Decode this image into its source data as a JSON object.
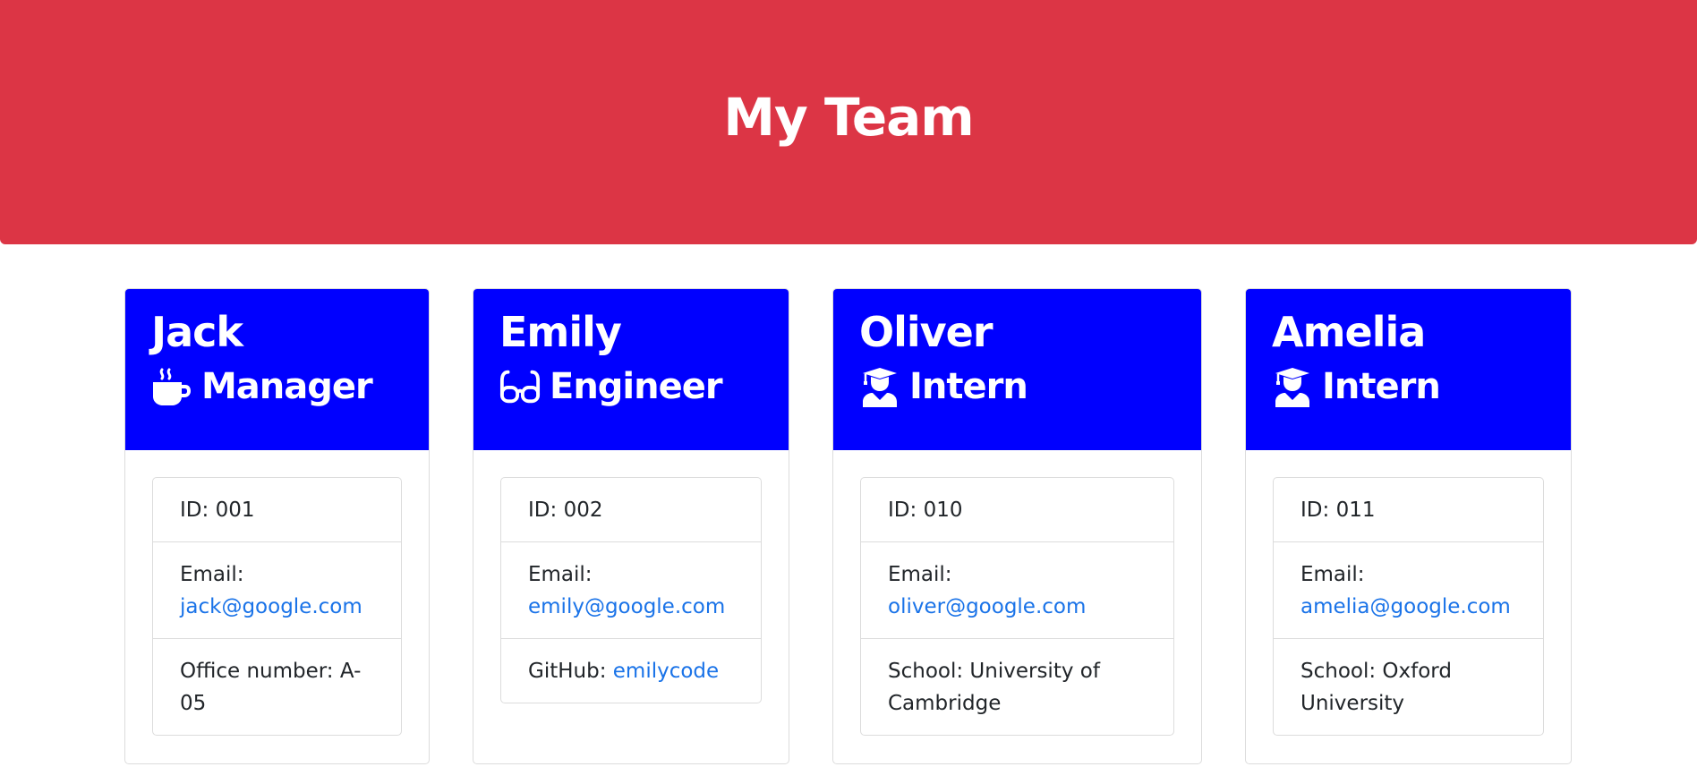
{
  "header": {
    "title": "My Team",
    "background_color": "#dc3545"
  },
  "card_header_color": "#0000ff",
  "link_color": "#1a73e8",
  "team": [
    {
      "name": "Jack",
      "role": "Manager",
      "role_icon": "coffee-mug-icon",
      "id_label": "ID:",
      "id": "001",
      "email_label": "Email:",
      "email": "jack@google.com",
      "extra_label": "Office number:",
      "extra_value": "A-05"
    },
    {
      "name": "Emily",
      "role": "Engineer",
      "role_icon": "glasses-icon",
      "id_label": "ID:",
      "id": "002",
      "email_label": "Email:",
      "email": "emily@google.com",
      "extra_label": "GitHub:",
      "extra_value": "emilycode"
    },
    {
      "name": "Oliver",
      "role": "Intern",
      "role_icon": "graduate-icon",
      "id_label": "ID:",
      "id": "010",
      "email_label": "Email:",
      "email": "oliver@google.com",
      "extra_label": "School:",
      "extra_value": "University of Cambridge"
    },
    {
      "name": "Amelia",
      "role": "Intern",
      "role_icon": "graduate-icon",
      "id_label": "ID:",
      "id": "011",
      "email_label": "Email:",
      "email": "amelia@google.com",
      "extra_label": "School:",
      "extra_value": "Oxford University"
    }
  ]
}
